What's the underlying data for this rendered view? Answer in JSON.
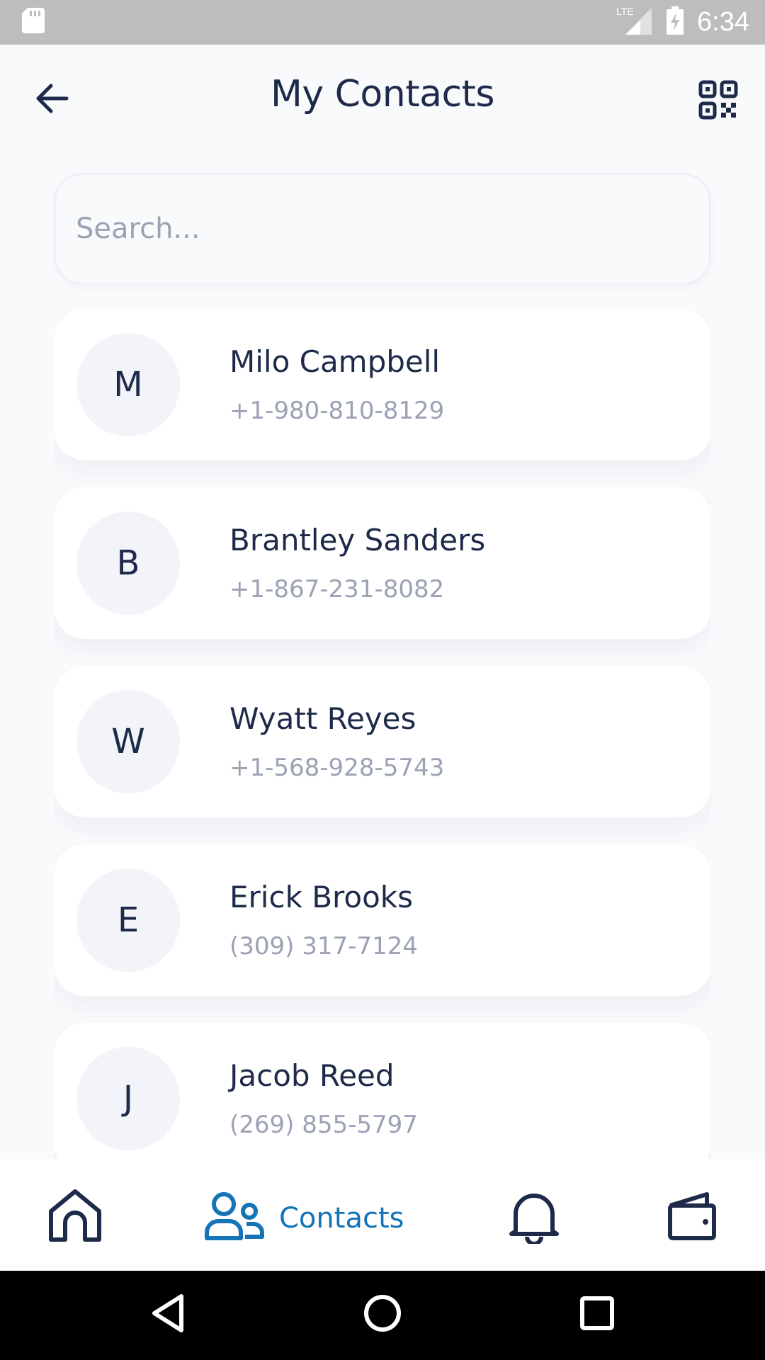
{
  "status_bar": {
    "time": "6:34",
    "network": "LTE",
    "icons": [
      "sd-card-icon",
      "signal-icon",
      "battery-charging-icon"
    ]
  },
  "header": {
    "title": "My Contacts",
    "back_icon": "arrow-left-icon",
    "qr_icon": "qr-code-icon"
  },
  "search": {
    "placeholder": "Search...",
    "value": ""
  },
  "contacts": [
    {
      "initial": "M",
      "name": "Milo Campbell",
      "phone": "+1-980-810-8129"
    },
    {
      "initial": "B",
      "name": "Brantley Sanders",
      "phone": "+1-867-231-8082"
    },
    {
      "initial": "W",
      "name": "Wyatt Reyes",
      "phone": "+1-568-928-5743"
    },
    {
      "initial": "E",
      "name": "Erick Brooks",
      "phone": "(309) 317-7124"
    },
    {
      "initial": "J",
      "name": "Jacob Reed",
      "phone": "(269) 855-5797"
    }
  ],
  "bottom_nav": {
    "items": [
      {
        "icon": "home-icon",
        "label": "",
        "active": false
      },
      {
        "icon": "contacts-icon",
        "label": "Contacts",
        "active": true
      },
      {
        "icon": "bell-icon",
        "label": "",
        "active": false
      },
      {
        "icon": "wallet-icon",
        "label": "",
        "active": false
      }
    ]
  },
  "system_nav": {
    "icons": [
      "back-triangle-icon",
      "home-circle-icon",
      "recents-square-icon"
    ]
  },
  "colors": {
    "primary_text": "#1e2a4a",
    "secondary_text": "#9aa2b4",
    "accent": "#1474b7",
    "background": "#f9fafc",
    "card": "#ffffff",
    "avatar_bg": "#f2f4f9"
  }
}
